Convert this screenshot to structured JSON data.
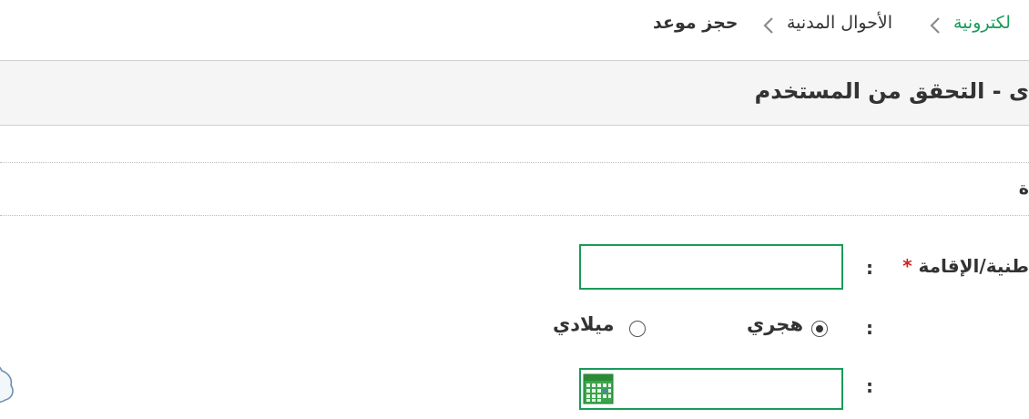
{
  "breadcrumb": {
    "link_partial": "لكترونية",
    "middle": "الأحوال المدنية",
    "current": "حجز موعد"
  },
  "header": {
    "title": "ى - التحقق من المستخدم"
  },
  "section": {
    "label": "ة"
  },
  "form": {
    "id_label": "طنية/الإقامة",
    "required_marker": "*",
    "colon": ":",
    "id_value": "",
    "calendar_type": {
      "options": [
        "هجري",
        "ميلادي"
      ],
      "selected": "هجري"
    },
    "date_value": ""
  },
  "colors": {
    "accent": "#1a9b5a",
    "required": "#d21e1e",
    "band_bg": "#f5f5f5"
  },
  "icons": {
    "breadcrumb_separator": "chevron-left-icon",
    "calendar": "calendar-icon"
  }
}
